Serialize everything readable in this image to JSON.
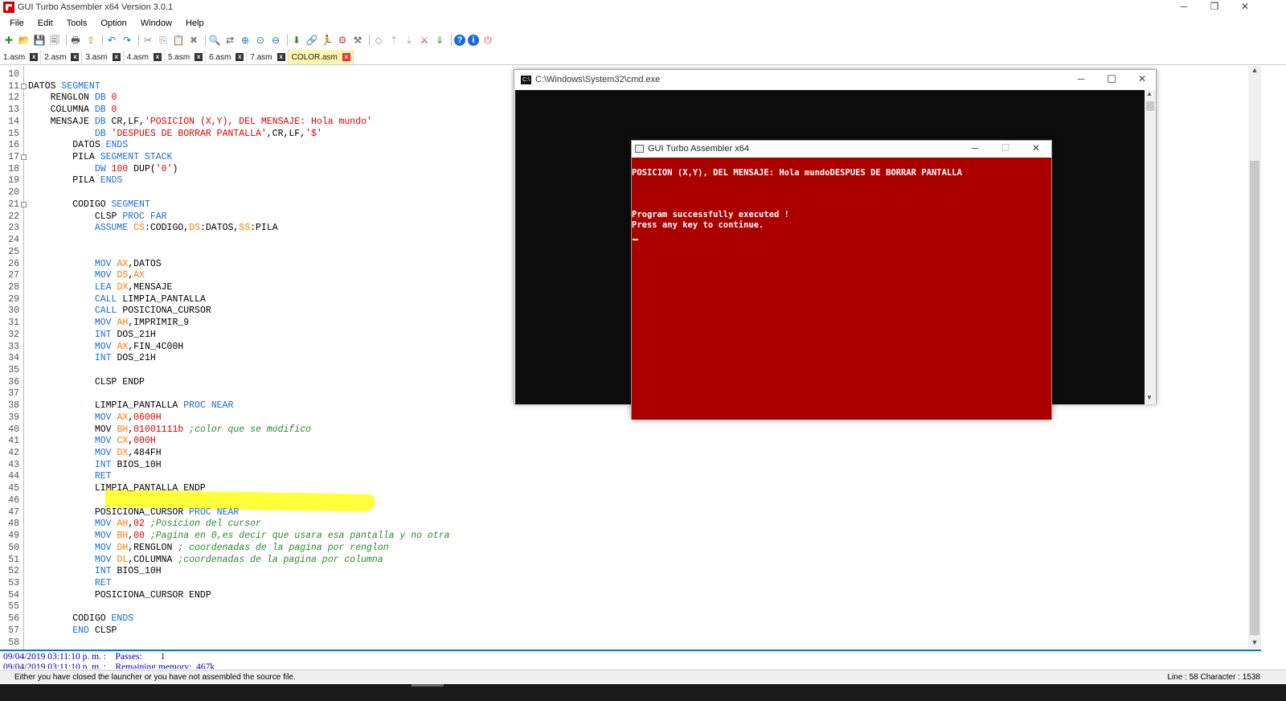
{
  "window": {
    "title": "GUI Turbo Assembler x64 Version 3.0.1",
    "minimize": "─",
    "restore": "❐",
    "close": "✕"
  },
  "menu": [
    "File",
    "Edit",
    "Tools",
    "Option",
    "Window",
    "Help"
  ],
  "toolbar": {
    "icons": [
      "new-file-icon",
      "open-folder-icon",
      "save-icon",
      "save-all-icon",
      "print-icon",
      "export-icon",
      "undo-icon",
      "redo-icon",
      "cut-icon",
      "copy-icon",
      "paste-icon",
      "delete-icon",
      "find-icon",
      "replace-icon",
      "zoom-in-icon",
      "zoom-reset-icon",
      "zoom-out-icon",
      "assemble-icon",
      "link-icon",
      "run-icon",
      "debug-icon",
      "debug-options-icon",
      "navigate-back-icon",
      "step-up-icon",
      "step-down-icon",
      "build-tools-icon",
      "download-icon",
      "help-icon",
      "info-icon",
      "power-icon"
    ],
    "glyphs": [
      "✚",
      "📂",
      "💾",
      "🗐",
      "🖶",
      "⇪",
      "↶",
      "↷",
      "✂",
      "⎘",
      "📋",
      "✖",
      "🔍",
      "⇄",
      "⊕",
      "⊙",
      "⊖",
      "⬇",
      "🔗",
      "🏃",
      "⚙",
      "⚒",
      "◇",
      "⇡",
      "⇣",
      "⚔",
      "⇓",
      "?",
      "i",
      "⏻"
    ]
  },
  "tabs": [
    {
      "label": "1.asm",
      "active": false
    },
    {
      "label": "2.asm",
      "active": false
    },
    {
      "label": "3.asm",
      "active": false
    },
    {
      "label": "4.asm",
      "active": false
    },
    {
      "label": "5.asm",
      "active": false
    },
    {
      "label": "6.asm",
      "active": false
    },
    {
      "label": "7.asm",
      "active": false
    },
    {
      "label": "COLOR.asm",
      "active": true
    }
  ],
  "tab_close_glyph": "x",
  "code_lines": [
    {
      "n": "10",
      "fold": false,
      "parts": [
        [
          "",
          ""
        ]
      ]
    },
    {
      "n": "11",
      "fold": true,
      "parts": [
        [
          "",
          "DATOS "
        ],
        [
          "kw",
          "SEGMENT"
        ]
      ]
    },
    {
      "n": "12",
      "fold": false,
      "parts": [
        [
          "",
          "    RENGLON "
        ],
        [
          "kw",
          "DB "
        ],
        [
          "num",
          "0"
        ]
      ]
    },
    {
      "n": "13",
      "fold": false,
      "parts": [
        [
          "",
          "    COLUMNA "
        ],
        [
          "kw",
          "DB "
        ],
        [
          "num",
          "0"
        ]
      ]
    },
    {
      "n": "14",
      "fold": false,
      "parts": [
        [
          "",
          "    MENSAJE "
        ],
        [
          "kw",
          "DB "
        ],
        [
          "",
          "CR,LF,"
        ],
        [
          "str",
          "'POSICION (X,Y), DEL MENSAJE: Hola mundo'"
        ]
      ]
    },
    {
      "n": "15",
      "fold": false,
      "parts": [
        [
          "",
          "            "
        ],
        [
          "kw",
          "DB "
        ],
        [
          "str",
          "'DESPUES DE BORRAR PANTALLA'"
        ],
        [
          "",
          ",CR,LF,"
        ],
        [
          "str",
          "'$'"
        ]
      ]
    },
    {
      "n": "16",
      "fold": false,
      "parts": [
        [
          "",
          "        DATOS "
        ],
        [
          "kw",
          "ENDS"
        ]
      ]
    },
    {
      "n": "17",
      "fold": true,
      "parts": [
        [
          "",
          "        PILA "
        ],
        [
          "kw",
          "SEGMENT STACK"
        ]
      ]
    },
    {
      "n": "18",
      "fold": false,
      "parts": [
        [
          "",
          "            "
        ],
        [
          "kw",
          "DW "
        ],
        [
          "num",
          "100 "
        ],
        [
          "",
          "DUP("
        ],
        [
          "str",
          "'0'"
        ],
        [
          "",
          ")"
        ]
      ]
    },
    {
      "n": "19",
      "fold": false,
      "parts": [
        [
          "",
          "        PILA "
        ],
        [
          "kw",
          "ENDS"
        ]
      ]
    },
    {
      "n": "20",
      "fold": false,
      "parts": [
        [
          "",
          ""
        ]
      ]
    },
    {
      "n": "21",
      "fold": true,
      "parts": [
        [
          "",
          "        CODIGO "
        ],
        [
          "kw",
          "SEGMENT"
        ]
      ]
    },
    {
      "n": "22",
      "fold": false,
      "parts": [
        [
          "",
          "            CLSP "
        ],
        [
          "kw",
          "PROC FAR"
        ]
      ]
    },
    {
      "n": "23",
      "fold": false,
      "parts": [
        [
          "",
          "            "
        ],
        [
          "kw",
          "ASSUME "
        ],
        [
          "reg",
          "CS"
        ],
        [
          "",
          ":CODIGO,"
        ],
        [
          "reg",
          "DS"
        ],
        [
          "",
          ":DATOS,"
        ],
        [
          "reg",
          "SS"
        ],
        [
          "",
          ":PILA"
        ]
      ]
    },
    {
      "n": "24",
      "fold": false,
      "parts": [
        [
          "",
          ""
        ]
      ]
    },
    {
      "n": "25",
      "fold": false,
      "parts": [
        [
          "",
          ""
        ]
      ]
    },
    {
      "n": "26",
      "fold": false,
      "parts": [
        [
          "",
          "            "
        ],
        [
          "kw",
          "MOV "
        ],
        [
          "reg",
          "AX"
        ],
        [
          "",
          ",DATOS"
        ]
      ]
    },
    {
      "n": "27",
      "fold": false,
      "parts": [
        [
          "",
          "            "
        ],
        [
          "kw",
          "MOV "
        ],
        [
          "reg",
          "DS"
        ],
        [
          "",
          ","
        ],
        [
          "reg",
          "AX"
        ]
      ]
    },
    {
      "n": "28",
      "fold": false,
      "parts": [
        [
          "",
          "            "
        ],
        [
          "kw",
          "LEA "
        ],
        [
          "reg",
          "DX"
        ],
        [
          "",
          ",MENSAJE"
        ]
      ]
    },
    {
      "n": "29",
      "fold": false,
      "parts": [
        [
          "",
          "            "
        ],
        [
          "kw",
          "CALL "
        ],
        [
          "",
          "LIMPIA_PANTALLA"
        ]
      ]
    },
    {
      "n": "30",
      "fold": false,
      "parts": [
        [
          "",
          "            "
        ],
        [
          "kw",
          "CALL "
        ],
        [
          "",
          "POSICIONA_CURSOR"
        ]
      ]
    },
    {
      "n": "31",
      "fold": false,
      "parts": [
        [
          "",
          "            "
        ],
        [
          "kw",
          "MOV "
        ],
        [
          "reg",
          "AH"
        ],
        [
          "",
          ",IMPRIMIR_9"
        ]
      ]
    },
    {
      "n": "32",
      "fold": false,
      "parts": [
        [
          "",
          "            "
        ],
        [
          "kw",
          "INT "
        ],
        [
          "",
          "DOS_21H"
        ]
      ]
    },
    {
      "n": "33",
      "fold": false,
      "parts": [
        [
          "",
          "            "
        ],
        [
          "kw",
          "MOV "
        ],
        [
          "reg",
          "AX"
        ],
        [
          "",
          ",FIN_4C00H"
        ]
      ]
    },
    {
      "n": "34",
      "fold": false,
      "parts": [
        [
          "",
          "            "
        ],
        [
          "kw",
          "INT "
        ],
        [
          "",
          "DOS_21H"
        ]
      ]
    },
    {
      "n": "35",
      "fold": false,
      "parts": [
        [
          "",
          ""
        ]
      ]
    },
    {
      "n": "36",
      "fold": false,
      "parts": [
        [
          "",
          "            CLSP ENDP"
        ]
      ]
    },
    {
      "n": "37",
      "fold": false,
      "parts": [
        [
          "",
          ""
        ]
      ]
    },
    {
      "n": "38",
      "fold": false,
      "parts": [
        [
          "",
          "            LIMPIA_PANTALLA "
        ],
        [
          "kw",
          "PROC NEAR"
        ]
      ]
    },
    {
      "n": "39",
      "fold": false,
      "parts": [
        [
          "",
          "            "
        ],
        [
          "kw",
          "MOV "
        ],
        [
          "reg",
          "AX"
        ],
        [
          "",
          ","
        ],
        [
          "num",
          "0600H"
        ]
      ]
    },
    {
      "n": "40",
      "fold": false,
      "parts": [
        [
          "",
          "            "
        ],
        [
          "",
          "MOV "
        ],
        [
          "reg",
          "BH"
        ],
        [
          "",
          ","
        ],
        [
          "num",
          "01001111b "
        ],
        [
          "cmt",
          ";color que se modifico"
        ]
      ]
    },
    {
      "n": "41",
      "fold": false,
      "parts": [
        [
          "",
          "            "
        ],
        [
          "kw",
          "MOV "
        ],
        [
          "reg",
          "CX"
        ],
        [
          "",
          ","
        ],
        [
          "num",
          "000H"
        ]
      ]
    },
    {
      "n": "42",
      "fold": false,
      "parts": [
        [
          "",
          "            "
        ],
        [
          "kw",
          "MOV "
        ],
        [
          "reg",
          "DX"
        ],
        [
          "",
          ",484FH"
        ]
      ]
    },
    {
      "n": "43",
      "fold": false,
      "parts": [
        [
          "",
          "            "
        ],
        [
          "kw",
          "INT "
        ],
        [
          "",
          "BIOS_10H"
        ]
      ]
    },
    {
      "n": "44",
      "fold": false,
      "parts": [
        [
          "",
          "            "
        ],
        [
          "kw",
          "RET"
        ]
      ]
    },
    {
      "n": "45",
      "fold": false,
      "parts": [
        [
          "",
          "            LIMPIA_PANTALLA ENDP"
        ]
      ]
    },
    {
      "n": "46",
      "fold": false,
      "parts": [
        [
          "",
          ""
        ]
      ]
    },
    {
      "n": "47",
      "fold": false,
      "parts": [
        [
          "",
          "            POSICIONA_CURSOR "
        ],
        [
          "kw",
          "PROC NEAR"
        ]
      ]
    },
    {
      "n": "48",
      "fold": false,
      "parts": [
        [
          "",
          "            "
        ],
        [
          "kw",
          "MOV "
        ],
        [
          "reg",
          "AH"
        ],
        [
          "",
          ","
        ],
        [
          "num",
          "02 "
        ],
        [
          "cmt",
          ";Posicion del cursor"
        ]
      ]
    },
    {
      "n": "49",
      "fold": false,
      "parts": [
        [
          "",
          "            "
        ],
        [
          "kw",
          "MOV "
        ],
        [
          "reg",
          "BH"
        ],
        [
          "",
          ","
        ],
        [
          "num",
          "00 "
        ],
        [
          "cmt",
          ";Pagina en 0,es decir que usara esa pantalla y no otra"
        ]
      ]
    },
    {
      "n": "50",
      "fold": false,
      "parts": [
        [
          "",
          "            "
        ],
        [
          "kw",
          "MOV "
        ],
        [
          "reg",
          "DH"
        ],
        [
          "",
          ",RENGLON "
        ],
        [
          "cmt",
          "; coordenadas de la pagina por renglon"
        ]
      ]
    },
    {
      "n": "51",
      "fold": false,
      "parts": [
        [
          "",
          "            "
        ],
        [
          "kw",
          "MOV "
        ],
        [
          "reg",
          "DL"
        ],
        [
          "",
          ",COLUMNA "
        ],
        [
          "cmt",
          ";coordenadas de la pagina por columna"
        ]
      ]
    },
    {
      "n": "52",
      "fold": false,
      "parts": [
        [
          "",
          "            "
        ],
        [
          "kw",
          "INT "
        ],
        [
          "",
          "BIOS_10H"
        ]
      ]
    },
    {
      "n": "53",
      "fold": false,
      "parts": [
        [
          "",
          "            "
        ],
        [
          "kw",
          "RET"
        ]
      ]
    },
    {
      "n": "54",
      "fold": false,
      "parts": [
        [
          "",
          "            POSICIONA_CURSOR ENDP"
        ]
      ]
    },
    {
      "n": "55",
      "fold": false,
      "parts": [
        [
          "",
          ""
        ]
      ]
    },
    {
      "n": "56",
      "fold": false,
      "parts": [
        [
          "",
          "        CODIGO "
        ],
        [
          "kw",
          "ENDS"
        ]
      ]
    },
    {
      "n": "57",
      "fold": false,
      "parts": [
        [
          "",
          "        "
        ],
        [
          "kw",
          "END "
        ],
        [
          "",
          "CLSP"
        ]
      ]
    },
    {
      "n": "58",
      "fold": false,
      "parts": [
        [
          "",
          ""
        ]
      ]
    }
  ],
  "output": [
    "09/04/2019 03:11:10 p. m. :    Passes:        1",
    "09/04/2019 03:11:10 p. m. :    Remaining memory:  467k"
  ],
  "status": {
    "message": "Either you have closed the launcher or you have not assembled the source file.",
    "position": "Line : 58 Character : 1538"
  },
  "cmd": {
    "title": "C:\\Windows\\System32\\cmd.exe",
    "icon_text": "C:\\"
  },
  "tasm": {
    "title": "GUI Turbo Assembler x64",
    "line1": "POSICION (X,Y), DEL MENSAJE: Hola mundoDESPUES DE BORRAR PANTALLA",
    "line2": "Program successfully executed !",
    "line3": "Press any key to continue.",
    "bg_color": "#aa0000"
  },
  "scroll_up": "▲",
  "scroll_down": "▼"
}
